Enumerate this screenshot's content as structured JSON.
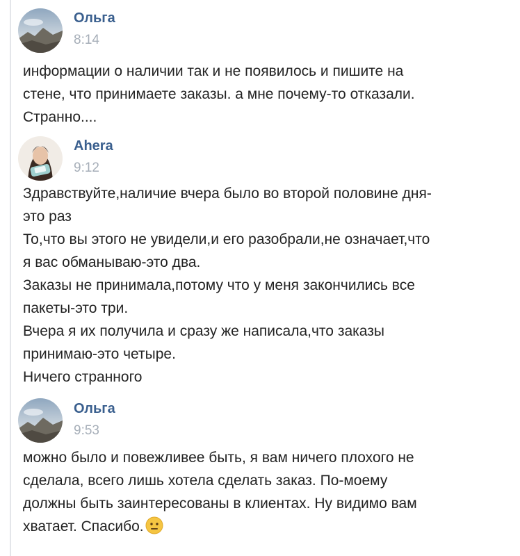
{
  "messages": [
    {
      "author": "Ольга",
      "time": "8:14",
      "lines": [
        "информации о наличии так и не появилось и пишите на",
        "стене, что принимаете заказы. а мне почему-то отказали.",
        "Странно...."
      ]
    },
    {
      "author": "Ahera",
      "time": "9:12",
      "lines": [
        "Здравствуйте,наличие вчера было во второй половине дня-",
        "это раз",
        "То,что вы этого не увидели,и его разобрали,не означает,что",
        "я вас обманываю-это два.",
        "Заказы не принимала,потому что у меня закончились все",
        "пакеты-это три.",
        "Вчера я их получила и сразу же написала,что заказы",
        "принимаю-это четыре.",
        "Ничего странного"
      ]
    },
    {
      "author": "Ольга",
      "time": "9:53",
      "lines": [
        "можно было и повежливее быть, я вам ничего плохого не",
        "сделала, всего лишь хотела сделать заказ. По-моему",
        "должны быть заинтересованы в клиентах. Ну видимо вам",
        "хватает. Спасибо."
      ],
      "trailing_emoji": "neutral-face-emoji"
    }
  ]
}
